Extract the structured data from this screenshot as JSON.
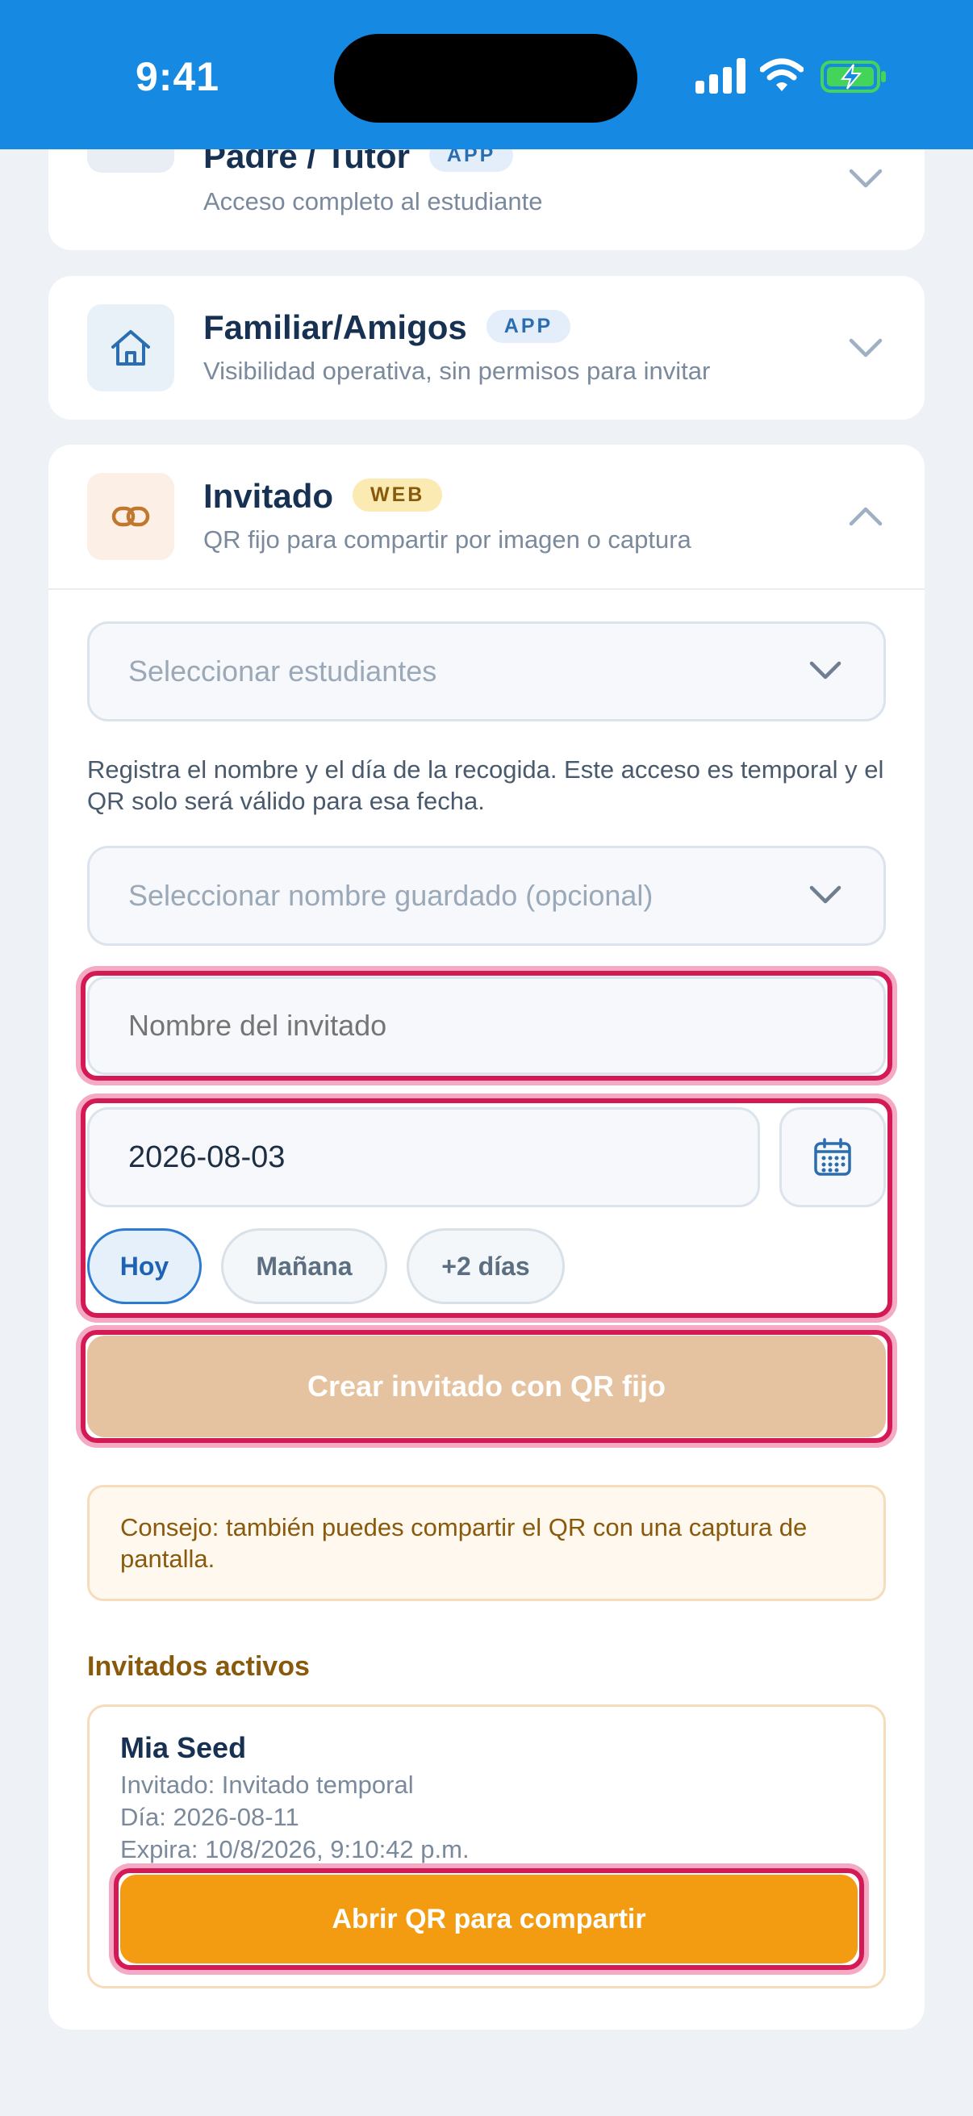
{
  "status": {
    "time": "9:41"
  },
  "cards": {
    "padre": {
      "title": "Padre / Tutor",
      "badge": "APP",
      "subtitle": "Acceso completo al estudiante",
      "icon": "shield-check-icon"
    },
    "familiar": {
      "title": "Familiar/Amigos",
      "badge": "APP",
      "subtitle": "Visibilidad operativa, sin permisos para invitar",
      "icon": "house-icon"
    },
    "invitado": {
      "title": "Invitado",
      "badge": "WEB",
      "subtitle": "QR fijo para compartir por imagen o captura",
      "icon": "link-icon",
      "students_placeholder": "Seleccionar estudiantes",
      "description": "Registra el nombre y el día de la recogida. Este acceso es temporal y el QR solo será válido para esa fecha.",
      "saved_name_placeholder": "Seleccionar nombre guardado (opcional)",
      "guest_name_placeholder": "Nombre del invitado",
      "date_value": "2026-08-03",
      "chips": [
        "Hoy",
        "Mañana",
        "+2 días"
      ],
      "active_chip": "Hoy",
      "create_button": "Crear invitado con QR fijo",
      "tip": "Consejo: también puedes compartir el QR con una captura de pantalla.",
      "active_heading": "Invitados activos",
      "active_guest": {
        "name": "Mia Seed",
        "guest_line": "Invitado: Invitado temporal",
        "day_line": "Día: 2026-08-11",
        "expires_line": "Expira: 10/8/2026, 9:10:42 p.m.",
        "open_button": "Abrir QR para compartir"
      }
    }
  },
  "colors": {
    "status_bar": "#1689e3",
    "accent_blue": "#1e62b4",
    "orange": "#f39c12",
    "create_disabled": "#e6c3a0",
    "highlight": "#d41a55"
  }
}
